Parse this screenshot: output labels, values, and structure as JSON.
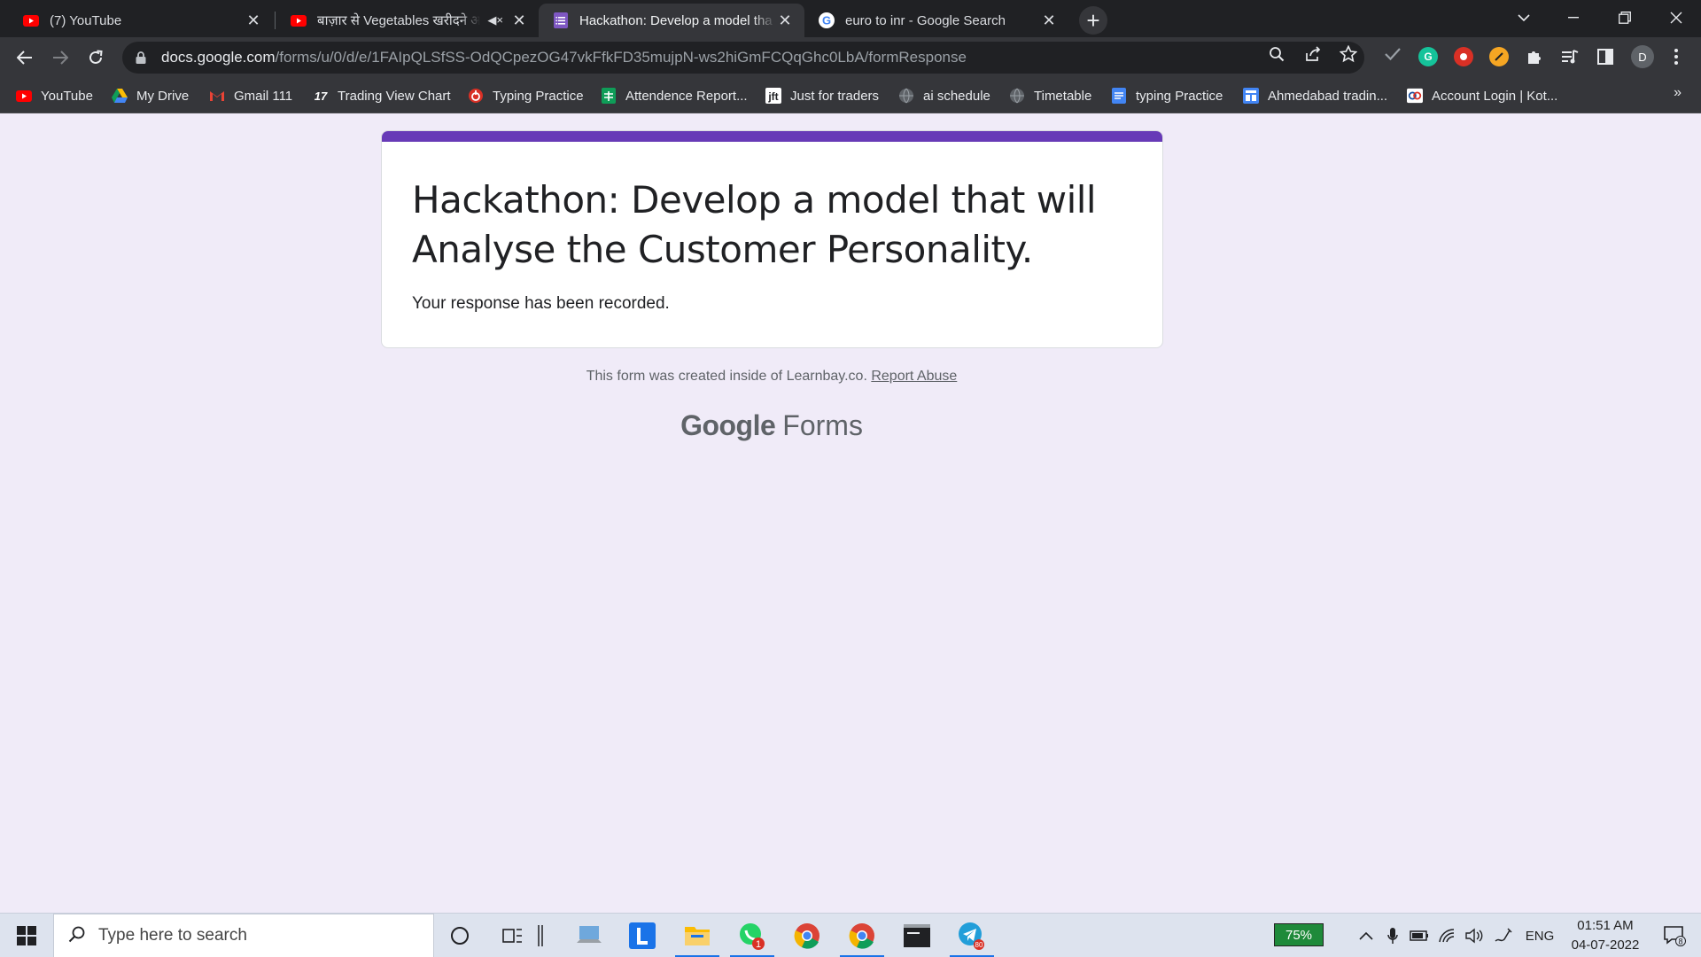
{
  "browser": {
    "tabs": [
      {
        "title": "(7) YouTube",
        "favicon": "youtube-icon"
      },
      {
        "title": "बाज़ार से Vegetables खरीदने अ",
        "favicon": "youtube-icon",
        "muted": true
      },
      {
        "title": "Hackathon: Develop a model tha",
        "favicon": "google-forms-icon",
        "active": true
      },
      {
        "title": "euro to inr - Google Search",
        "favicon": "google-icon"
      }
    ],
    "url_host": "docs.google.com",
    "url_path": "/forms/u/0/d/e/1FAIpQLSfSS-OdQCpezOG47vkFfkFD35mujpN-ws2hiGmFCQqGhc0LbA/formResponse",
    "profile_initial": "D",
    "bookmarks": [
      {
        "label": "YouTube",
        "icon": "youtube-icon"
      },
      {
        "label": "My Drive",
        "icon": "drive-icon"
      },
      {
        "label": "Gmail 111",
        "icon": "gmail-icon"
      },
      {
        "label": "Trading View Chart",
        "icon": "tradingview-icon"
      },
      {
        "label": "Typing Practice",
        "icon": "typing-icon"
      },
      {
        "label": "Attendence Report...",
        "icon": "sheets-icon"
      },
      {
        "label": "Just for traders",
        "icon": "jft-icon"
      },
      {
        "label": "ai schedule",
        "icon": "globe-icon"
      },
      {
        "label": "Timetable",
        "icon": "globe-icon"
      },
      {
        "label": "typing Practice",
        "icon": "docs-icon"
      },
      {
        "label": "Ahmedabad tradin...",
        "icon": "site-icon"
      },
      {
        "label": "Account Login | Kot...",
        "icon": "kotak-icon"
      }
    ]
  },
  "form": {
    "title": "Hackathon:  Develop a model that will Analyse the Customer Personality.",
    "message": "Your response has been recorded.",
    "footer_prefix": "This form was created inside of Learnbay.co.",
    "report_abuse": "Report Abuse",
    "logo_google": "Google",
    "logo_forms": "Forms",
    "accent_color": "#673ab7"
  },
  "taskbar": {
    "search_placeholder": "Type here to search",
    "whatsapp_badge": "1",
    "telegram_badge": "80",
    "battery": "75%",
    "language": "ENG",
    "time": "01:51 AM",
    "date": "04-07-2022",
    "notifications": "8"
  }
}
